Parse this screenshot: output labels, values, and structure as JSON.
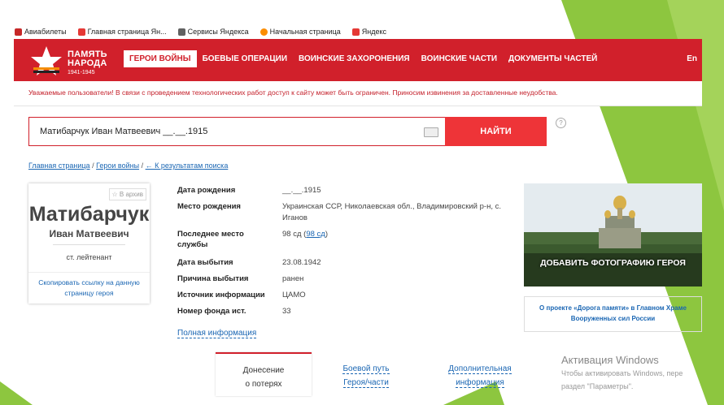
{
  "bookmarks": [
    {
      "label": "Авиабилеты",
      "icon": "plane-icon",
      "color": "#c62828"
    },
    {
      "label": "Главная страница Ян...",
      "icon": "yandex-icon",
      "color": "#e53935"
    },
    {
      "label": "Сервисы Яндекса",
      "icon": "folder-icon",
      "color": "#616161"
    },
    {
      "label": "Начальная страница",
      "icon": "chrome-icon",
      "color": "#fb8c00"
    },
    {
      "label": "Яндекс",
      "icon": "yandex-icon",
      "color": "#e53935"
    }
  ],
  "header": {
    "logo_line1": "ПАМЯТЬ",
    "logo_line2": "НАРОДА",
    "logo_years": "1941-1945",
    "nav": [
      "ГЕРОИ ВОЙНЫ",
      "БОЕВЫЕ ОПЕРАЦИИ",
      "ВОИНСКИЕ ЗАХОРОНЕНИЯ",
      "ВОИНСКИЕ ЧАСТИ",
      "ДОКУМЕНТЫ ЧАСТЕЙ"
    ],
    "active_nav": 0,
    "lang": "En",
    "brand_color": "#d1202b"
  },
  "notice": "Уважаемые пользователи! В связи с проведением технологических работ доступ к сайту может быть ограничен. Приносим извинения за доставленные неудобства.",
  "search": {
    "value": "Матибарчук Иван Матвеевич __.__.1915",
    "button": "НАЙТИ",
    "help": "?"
  },
  "breadcrumbs": {
    "home": "Главная страница",
    "sep": "/",
    "heroes": "Герои войны",
    "back": "← К результатам поиска"
  },
  "card": {
    "archive": "☆ В архив",
    "surname": "Матибарчук",
    "given": "Иван Матвеевич",
    "rank": "ст. лейтенант",
    "copy_line1": "Скопировать ссылку на данную",
    "copy_line2": "страницу героя"
  },
  "details": [
    {
      "label": "Дата рождения",
      "value": "__.__.1915"
    },
    {
      "label": "Место рождения",
      "value": "Украинская ССР, Николаевская обл., Владимировский р-н, с. Иганов"
    },
    {
      "label": "Последнее место службы",
      "value_prefix": "98 сд (",
      "value_link": "98 сд",
      "value_suffix": ")"
    },
    {
      "label": "Дата выбытия",
      "value": "23.08.1942"
    },
    {
      "label": "Причина выбытия",
      "value": "ранен"
    },
    {
      "label": "Источник информации",
      "value": "ЦАМО"
    },
    {
      "label": "Номер фонда ист.",
      "value": "33"
    }
  ],
  "full_info": "Полная информация",
  "photo_label": "ДОБАВИТЬ ФОТОГРАФИЮ ГЕРОЯ",
  "promo": {
    "line1": "О проекте «Дорога памяти» в Главном Храме",
    "line2": "Вооруженных сил России"
  },
  "tabs": [
    {
      "line1": "Донесение",
      "line2": "о потерях"
    },
    {
      "line1": "Боевой путь",
      "line2": "Героя/части"
    },
    {
      "line1": "Дополнительная",
      "line2": "информация"
    }
  ],
  "activation": {
    "title": "Активация Windows",
    "line1": "Чтобы активировать Windows, пере",
    "line2": "раздел \"Параметры\"."
  },
  "slide_accent": "#8dc63f"
}
